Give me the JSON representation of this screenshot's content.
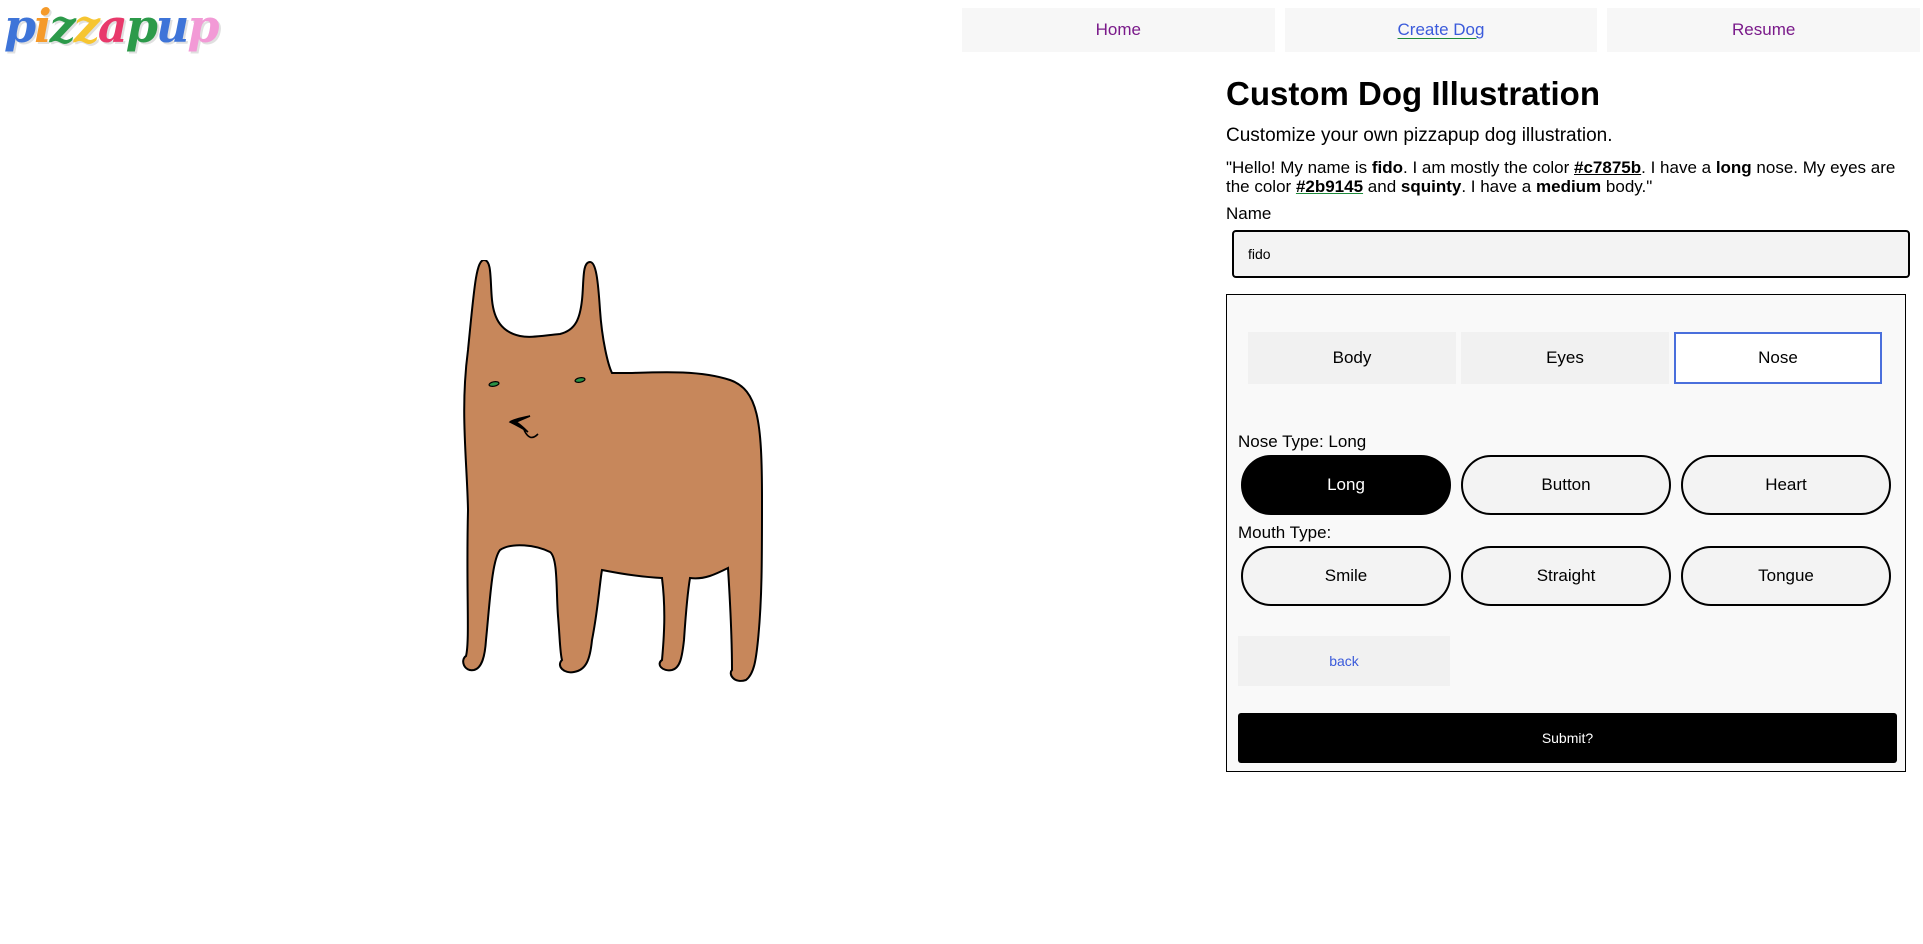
{
  "logo": {
    "letters": [
      {
        "ch": "p",
        "color": "#3e74d8"
      },
      {
        "ch": "i",
        "color": "#f59a2a"
      },
      {
        "ch": "z",
        "color": "#2c9a4a"
      },
      {
        "ch": "z",
        "color": "#f6c531"
      },
      {
        "ch": "a",
        "color": "#e8396b"
      },
      {
        "ch": "p",
        "color": "#2c9a4a"
      },
      {
        "ch": "u",
        "color": "#3e74d8"
      },
      {
        "ch": "p",
        "color": "#f29ad6"
      }
    ]
  },
  "nav": {
    "home": "Home",
    "create_dog": "Create Dog",
    "resume": "Resume"
  },
  "dog": {
    "color": "#c7875b",
    "eye_color": "#2b9145"
  },
  "page": {
    "title": "Custom Dog Illustration",
    "subtitle": "Customize your own pizzapup dog illustration.",
    "desc": {
      "p1": "\"Hello! My name is ",
      "name": "fido",
      "p2": ". I am mostly the color ",
      "color": "#c7875b",
      "p3": ". I have a ",
      "nose": "long",
      "p4": " nose. My eyes are the color ",
      "eye_color": "#2b9145",
      "p5": " and ",
      "eye_type": "squinty",
      "p6": ". I have a ",
      "body": "medium",
      "p7": " body.\""
    },
    "name_label": "Name",
    "name_value": "fido"
  },
  "tabs": {
    "body": "Body",
    "eyes": "Eyes",
    "nose": "Nose"
  },
  "nose_section": {
    "label": "Nose Type: Long",
    "options": [
      "Long",
      "Button",
      "Heart"
    ]
  },
  "mouth_section": {
    "label": "Mouth Type:",
    "options": [
      "Smile",
      "Straight",
      "Tongue"
    ]
  },
  "buttons": {
    "back": "back",
    "submit": "Submit?"
  }
}
